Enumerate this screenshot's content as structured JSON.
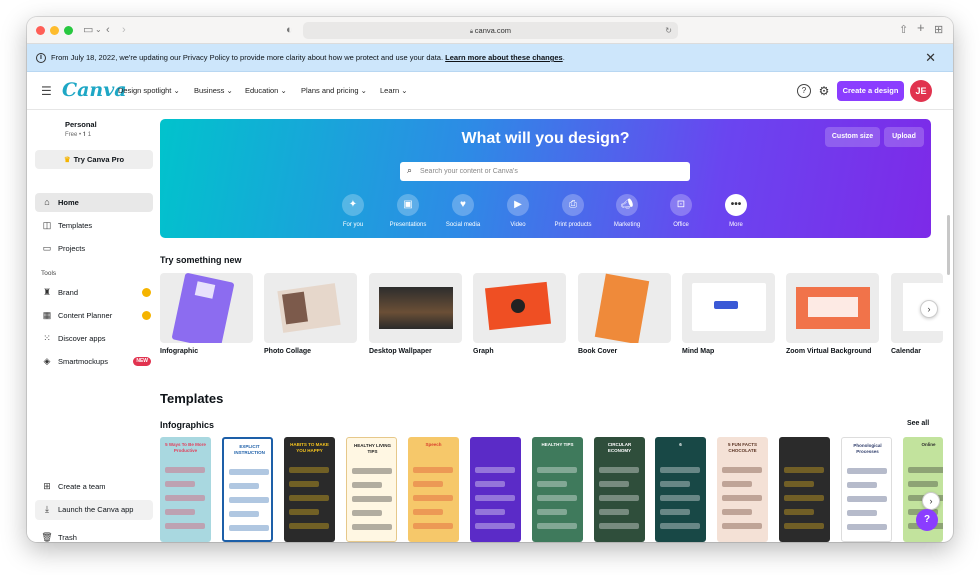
{
  "browser": {
    "url": "canva.com"
  },
  "banner": {
    "text": "From July 18, 2022, we're updating our Privacy Policy to provide more clarity about how we protect and use your data.",
    "link": "Learn more about these changes",
    "link_suffix": "."
  },
  "nav": {
    "logo": "Canva",
    "items": [
      "Design spotlight ⌄",
      "Business ⌄",
      "Education ⌄",
      "Plans and pricing ⌄",
      "Learn ⌄"
    ],
    "create_label": "Create a design",
    "avatar_initials": "JE"
  },
  "sidebar": {
    "account_name": "Personal",
    "plan": "Free • 𝟏 1",
    "try_pro": "Try Canva Pro",
    "items": [
      {
        "label": "Home",
        "icon": "home-icon"
      },
      {
        "label": "Templates",
        "icon": "templates-icon"
      },
      {
        "label": "Projects",
        "icon": "folder-icon"
      }
    ],
    "tools_heading": "Tools",
    "tools": [
      {
        "label": "Brand",
        "icon": "brand-icon"
      },
      {
        "label": "Content Planner",
        "icon": "calendar-icon"
      },
      {
        "label": "Discover apps",
        "icon": "apps-icon"
      },
      {
        "label": "Smartmockups",
        "icon": "mockup-icon",
        "badge": "NEW"
      }
    ],
    "bottom": [
      {
        "label": "Create a team",
        "icon": "team-icon"
      },
      {
        "label": "Launch the Canva app",
        "icon": "download-icon"
      },
      {
        "label": "Trash",
        "icon": "trash-icon"
      }
    ]
  },
  "hero": {
    "title": "What will you design?",
    "custom_size": "Custom size",
    "upload": "Upload",
    "search_placeholder": "Search your content or Canva's",
    "categories": [
      {
        "label": "For you",
        "icon": "sparkle-icon"
      },
      {
        "label": "Presentations",
        "icon": "presentation-icon"
      },
      {
        "label": "Social media",
        "icon": "heart-icon"
      },
      {
        "label": "Video",
        "icon": "video-icon"
      },
      {
        "label": "Print products",
        "icon": "printer-icon"
      },
      {
        "label": "Marketing",
        "icon": "megaphone-icon"
      },
      {
        "label": "Office",
        "icon": "briefcase-icon"
      },
      {
        "label": "More",
        "icon": "more-icon"
      }
    ]
  },
  "try_new": {
    "heading": "Try something new",
    "cards": [
      "Infographic",
      "Photo Collage",
      "Desktop Wallpaper",
      "Graph",
      "Book Cover",
      "Mind Map",
      "Zoom Virtual Background",
      "Calendar"
    ]
  },
  "templates": {
    "heading": "Templates",
    "subheading": "Infographics",
    "see_all": "See all",
    "thumbs": [
      {
        "title": "5 Ways To Be More Productive",
        "bg": "#a9d8e0",
        "fg": "#e23f5b"
      },
      {
        "title": "EXPLICIT INSTRUCTION",
        "bg": "#ffffff",
        "fg": "#1d5fa8"
      },
      {
        "title": "HABITS TO MAKE YOU HAPPY",
        "bg": "#2a2a2a",
        "fg": "#f7c51e"
      },
      {
        "title": "HEALTHY LIVING TIPS",
        "bg": "#fff7e3",
        "fg": "#222222"
      },
      {
        "title": "Speech",
        "bg": "#f6c86a",
        "fg": "#d9412e"
      },
      {
        "title": "",
        "bg": "#5b2bc7",
        "fg": "#ffffff"
      },
      {
        "title": "HEALTHY TIPS",
        "bg": "#3f7a5c",
        "fg": "#ffffff"
      },
      {
        "title": "CIRCULAR ECONOMY",
        "bg": "#2f4e3b",
        "fg": "#ffffff"
      },
      {
        "title": "6",
        "bg": "#184846",
        "fg": "#ffffff"
      },
      {
        "title": "5 FUN FACTS CHOCOLATE",
        "bg": "#f4e1d6",
        "fg": "#5b3423"
      },
      {
        "title": "",
        "bg": "#2b2b2b",
        "fg": "#f4c01e"
      },
      {
        "title": "Phonological Processes",
        "bg": "#ffffff",
        "fg": "#2f3d6b"
      },
      {
        "title": "Online",
        "bg": "#c2e39d",
        "fg": "#2b2b2b"
      }
    ]
  },
  "colors": {
    "brand_purple": "#8b3dff",
    "logo": "#1ea7c5",
    "avatar": "#e1334f"
  }
}
